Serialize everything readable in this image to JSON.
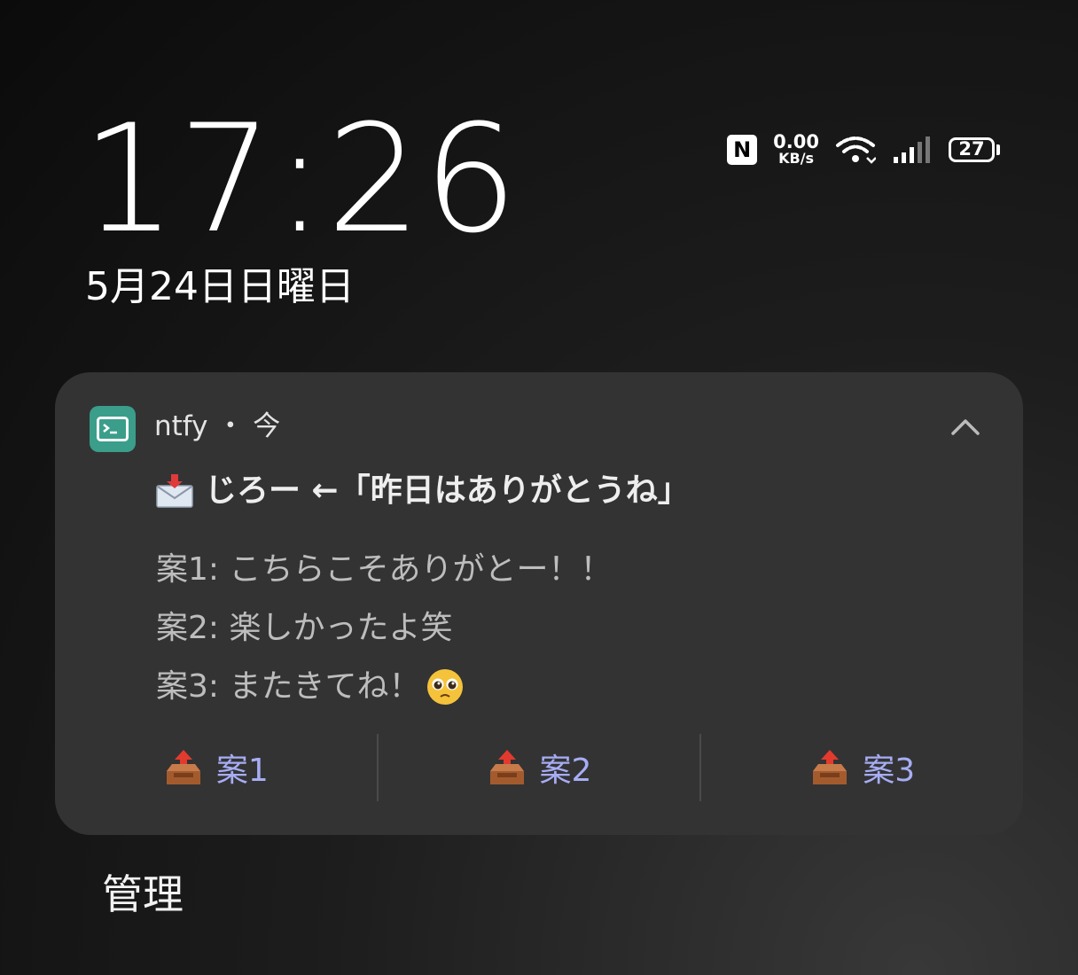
{
  "lockscreen": {
    "time": "17:26",
    "date": "5月24日日曜日"
  },
  "status_bar": {
    "net_speed_value": "0.00",
    "net_speed_unit": "KB/s",
    "battery_level": "27",
    "icons": [
      "nfc-icon",
      "wifi-icon",
      "signal-icon",
      "battery-icon"
    ]
  },
  "notification": {
    "app_name": "ntfy",
    "separator": "・",
    "time": "今",
    "title": "じろー ←「昨日はありがとうね」",
    "lines": [
      "案1: こちらこそありがとー！！",
      "案2: 楽しかったよ笑",
      "案3: またきてね！"
    ],
    "actions": [
      {
        "label": "案1"
      },
      {
        "label": "案2"
      },
      {
        "label": "案3"
      }
    ],
    "colors": {
      "card": "#333334",
      "app_icon": "#3a9e8a",
      "action_text": "#a7adf4"
    }
  },
  "footer": {
    "manage_label": "管理"
  }
}
